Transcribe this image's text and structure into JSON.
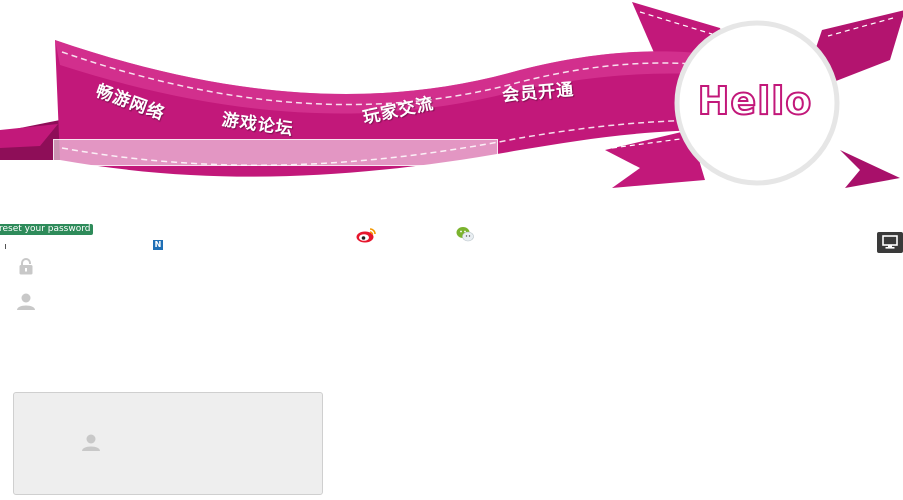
{
  "banner": {
    "nav": [
      {
        "label": "畅游网络"
      },
      {
        "label": "游戏论坛"
      },
      {
        "label": "玩家交流"
      },
      {
        "label": "会员开通"
      }
    ],
    "hello": "Hello",
    "colors": {
      "ribbon": "#c2187a",
      "ribbon_light": "#e0449c",
      "ribbon_dark": "#8e0e58",
      "badge": "#ffffff"
    }
  },
  "search": {
    "placeholder": ""
  },
  "account": {
    "reset_link": "reset your password",
    "n_badge": "N"
  },
  "icons": {
    "lock": "lock-icon",
    "user": "user-icon",
    "weibo": "weibo-icon",
    "wechat": "wechat-icon",
    "monitor": "monitor-icon"
  }
}
